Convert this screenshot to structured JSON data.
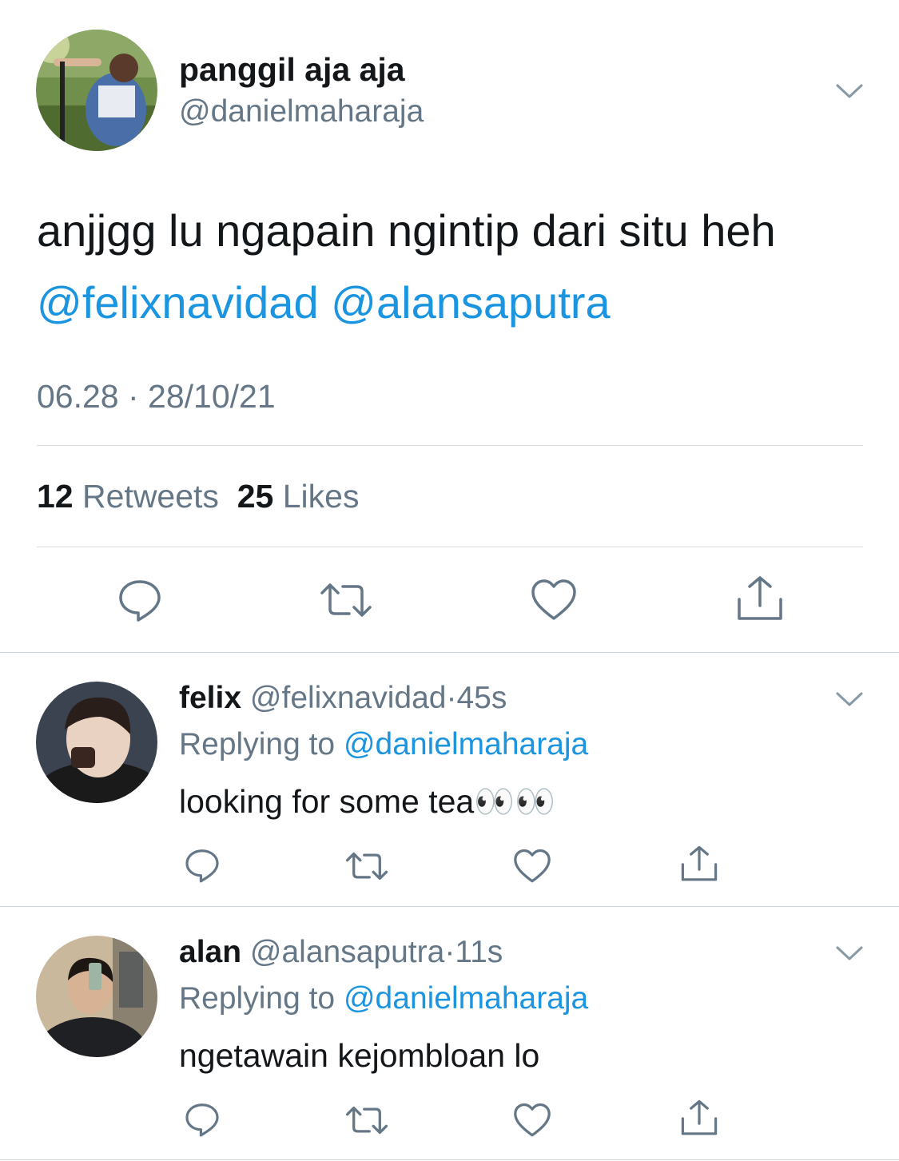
{
  "main_tweet": {
    "display_name": "panggil aja aja",
    "handle": "@danielmaharaja",
    "text": "anjjgg lu ngapain ngintip dari situ heh",
    "mentions": [
      "@felixnavidad",
      "@alansaputra"
    ],
    "timestamp": "06.28 · 28/10/21",
    "retweet_count": "12",
    "retweet_label": "Retweets",
    "like_count": "25",
    "like_label": "Likes"
  },
  "replies": [
    {
      "display_name": "felix",
      "handle": "@felixnavidad",
      "separator": "·",
      "time": "45s",
      "replying_label": "Replying to",
      "replying_to": "@danielmaharaja",
      "text": "looking for some tea👀👀"
    },
    {
      "display_name": "alan",
      "handle": "@alansaputra",
      "separator": "·",
      "time": "11s",
      "replying_label": "Replying to",
      "replying_to": "@danielmaharaja",
      "text": "ngetawain kejombloan lo"
    }
  ],
  "icons": {
    "reply": "speech-bubble-icon",
    "retweet": "retweet-arrows-icon",
    "like": "heart-outline-icon",
    "share": "share-upload-icon",
    "more": "chevron-down-icon"
  },
  "colors": {
    "link": "#1b95e0",
    "secondary_text": "#657786",
    "primary_text": "#14171a",
    "divider": "#d7dce0"
  }
}
